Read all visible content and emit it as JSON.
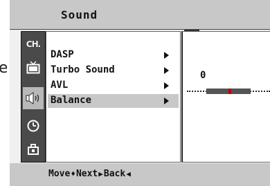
{
  "stray_text": "e",
  "header": {
    "title": "Sound"
  },
  "tabs": [
    {
      "name": "channel",
      "label": "CH.",
      "icon": "ch-icon"
    },
    {
      "name": "picture",
      "icon": "tv-icon"
    },
    {
      "name": "sound",
      "icon": "speaker-icon",
      "active": true
    },
    {
      "name": "time",
      "icon": "clock-icon"
    },
    {
      "name": "setup",
      "icon": "toolbox-icon"
    }
  ],
  "menu": {
    "items": [
      {
        "label": "DASP",
        "selected": false
      },
      {
        "label": "Turbo Sound",
        "selected": false
      },
      {
        "label": "AVL",
        "selected": false
      },
      {
        "label": "Balance",
        "selected": true
      }
    ]
  },
  "balance": {
    "value": "0",
    "level": 0
  },
  "footer": {
    "move_label": "Move",
    "next_label": "Next",
    "back_label": "Back",
    "move_glyph": "♦",
    "next_glyph": "▶",
    "back_glyph": "◀"
  },
  "colors": {
    "selected_bg": "#c8c8c8",
    "tab_bg": "#4a4a4a",
    "knob": "#b00000"
  }
}
